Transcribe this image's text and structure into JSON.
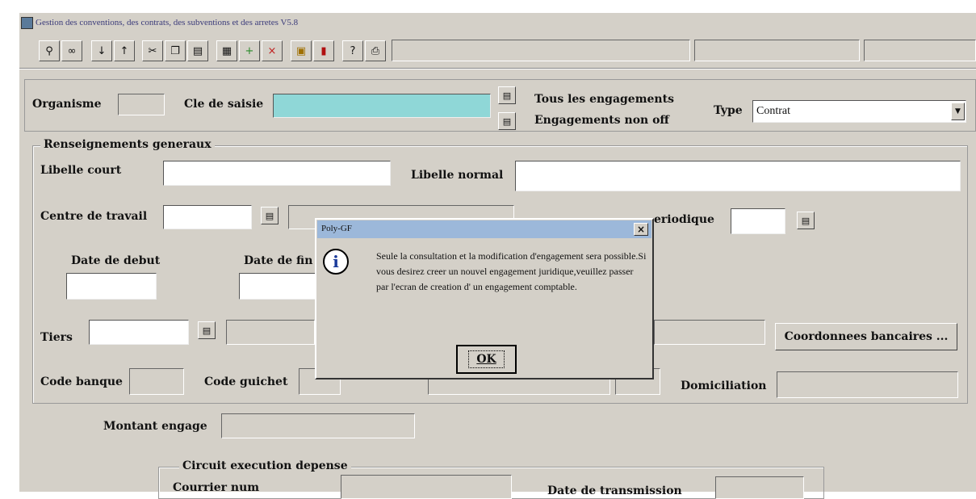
{
  "window": {
    "title": "Gestion des conventions, des contrats, des subventions et des arretes V5.8"
  },
  "toolbar": {
    "icons": [
      "search-icon",
      "binoculars-icon",
      "arrow-down-icon",
      "arrow-up-icon",
      "scissors-icon",
      "copy-icon",
      "paste-icon",
      "calculator-icon",
      "new-record-icon",
      "delete-record-icon",
      "save-icon",
      "exit-icon",
      "help-icon",
      "print-icon"
    ]
  },
  "header": {
    "organisme_label": "Organisme",
    "cle_label": "Cle de saisie",
    "tous_label": "Tous les engagements",
    "non_off_label": "Engagements non off",
    "type_label": "Type",
    "type_value": "Contrat"
  },
  "renseignements": {
    "group_label": "Renseignements generaux",
    "libelle_court_label": "Libelle court",
    "libelle_normal_label": "Libelle normal",
    "centre_label": "Centre de travail",
    "periodique_label": "eriodique",
    "date_debut_label": "Date de debut",
    "date_fin_label": "Date de fin",
    "tiers_label": "Tiers",
    "coordonnees_button": "Coordonnees bancaires ...",
    "code_banque_label": "Code banque",
    "code_guichet_label": "Code guichet",
    "domiciliation_label": "Domiciliation",
    "montant_label": "Montant engage"
  },
  "circuit": {
    "group_label": "Circuit execution depense",
    "courrier_label": "Courrier num",
    "date_transmission_label": "Date de transmission"
  },
  "dialog": {
    "title": "Poly-GF",
    "close": "×",
    "message": "Seule la consultation et la modification d'engagement sera possible.Si vous desirez creer un nouvel engagement juridique,veuillez passer par l'ecran de creation d' un engagement comptable.",
    "ok_label": "OK"
  },
  "colors": {
    "panel": "#d4d0c8",
    "cle_field": "#8fd7d7",
    "dialog_title": "#9cb8da"
  }
}
